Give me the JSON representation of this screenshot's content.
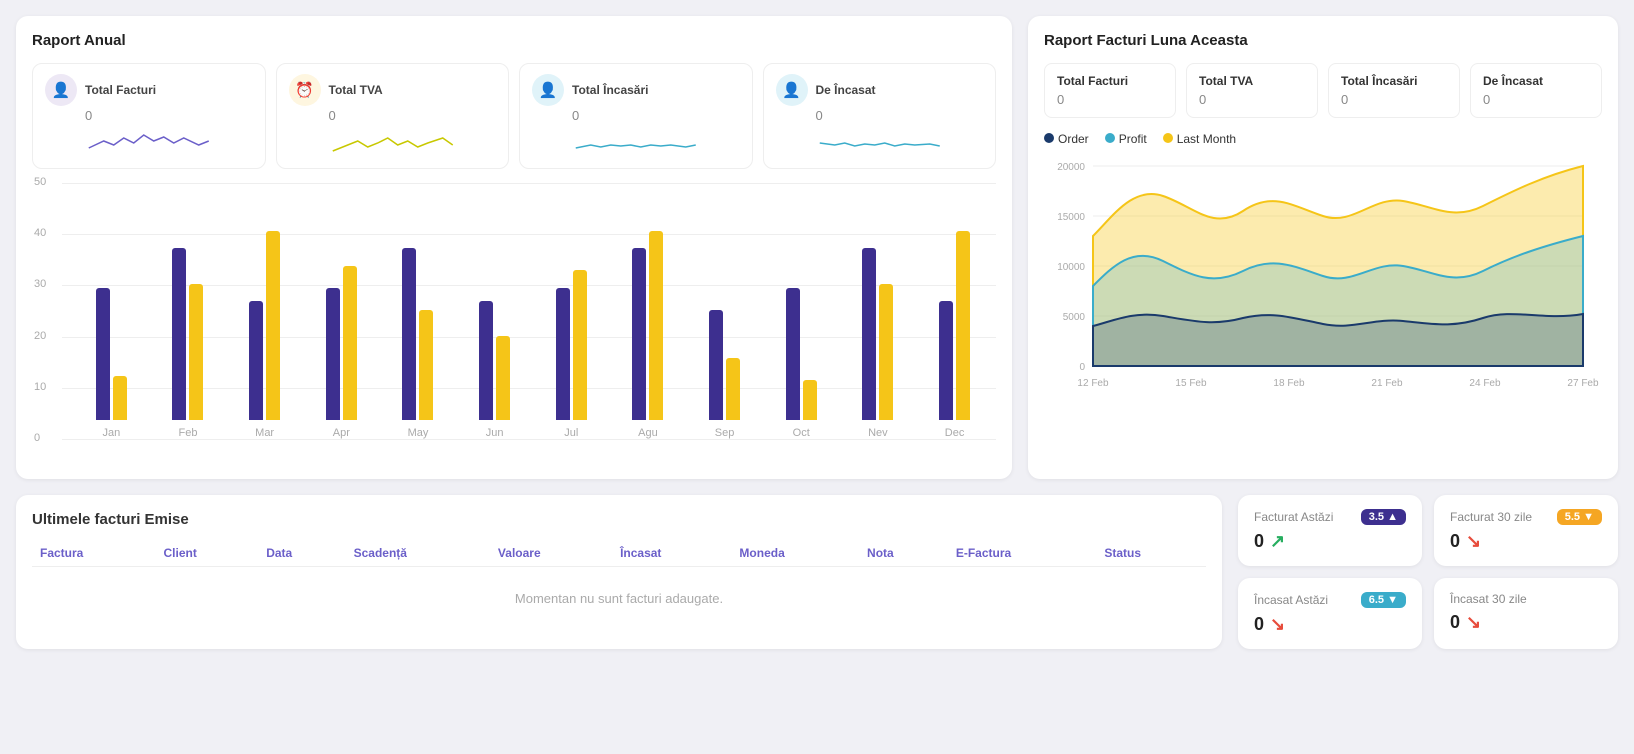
{
  "annual": {
    "title": "Raport Anual",
    "stats": [
      {
        "label": "Total Facturi",
        "value": "0",
        "iconType": "purple",
        "iconChar": "👤"
      },
      {
        "label": "Total TVA",
        "value": "0",
        "iconType": "yellow",
        "iconChar": "⏰"
      },
      {
        "label": "Total Încasări",
        "value": "0",
        "iconType": "blue",
        "iconChar": "👤"
      },
      {
        "label": "De Încasat",
        "value": "0",
        "iconType": "blue",
        "iconChar": "👤"
      }
    ],
    "barChart": {
      "months": [
        "Jan",
        "Feb",
        "Mar",
        "Apr",
        "May",
        "Jun",
        "Jul",
        "Agu",
        "Sep",
        "Oct",
        "Nev",
        "Dec"
      ],
      "purpleValues": [
        30,
        39,
        27,
        30,
        39,
        27,
        30,
        39,
        25,
        30,
        39,
        27
      ],
      "yellowValues": [
        10,
        31,
        43,
        35,
        25,
        19,
        34,
        43,
        14,
        9,
        31,
        43
      ],
      "yLabels": [
        "0",
        "10",
        "20",
        "30",
        "40",
        "50"
      ],
      "maxVal": 50
    }
  },
  "monthly": {
    "title": "Raport Facturi Luna Aceasta",
    "stats": [
      {
        "label": "Total Facturi",
        "value": "0"
      },
      {
        "label": "Total TVA",
        "value": "0"
      },
      {
        "label": "Total Încasări",
        "value": "0"
      },
      {
        "label": "De Încasat",
        "value": "0"
      }
    ],
    "legend": [
      {
        "label": "Order",
        "color": "#1a3a6b"
      },
      {
        "label": "Profit",
        "color": "#3aacca"
      },
      {
        "label": "Last Month",
        "color": "#f5c518"
      }
    ],
    "xLabels": [
      "12 Feb",
      "15 Feb",
      "18 Feb",
      "21 Feb",
      "24 Feb",
      "27 Feb"
    ],
    "yLabels": [
      "0",
      "5000",
      "10000",
      "15000",
      "20000"
    ]
  },
  "invoices": {
    "title": "Ultimele facturi Emise",
    "columns": [
      "Factura",
      "Client",
      "Data",
      "Scadență",
      "Valoare",
      "Încasat",
      "Moneda",
      "Nota",
      "E-Factura",
      "Status"
    ],
    "emptyMessage": "Momentan nu sunt facturi adaugate."
  },
  "rightStats": [
    {
      "title": "Facturat Astăzi",
      "value": "0",
      "badge": "3.5",
      "badgeType": "purple",
      "badgeArrow": "▲",
      "trend": "up",
      "trendIcon": "↗"
    },
    {
      "title": "Facturat 30 zile",
      "value": "0",
      "badge": "5.5",
      "badgeType": "orange",
      "badgeArrow": "▼",
      "trend": "down",
      "trendIcon": "↘"
    },
    {
      "title": "Încasat Astăzi",
      "value": "0",
      "badge": "6.5",
      "badgeType": "cyan",
      "badgeArrow": "▼",
      "trend": "down",
      "trendIcon": "↘"
    },
    {
      "title": "Încasat 30 zile",
      "value": "0",
      "badge": null,
      "trend": "down",
      "trendIcon": "↘"
    }
  ]
}
